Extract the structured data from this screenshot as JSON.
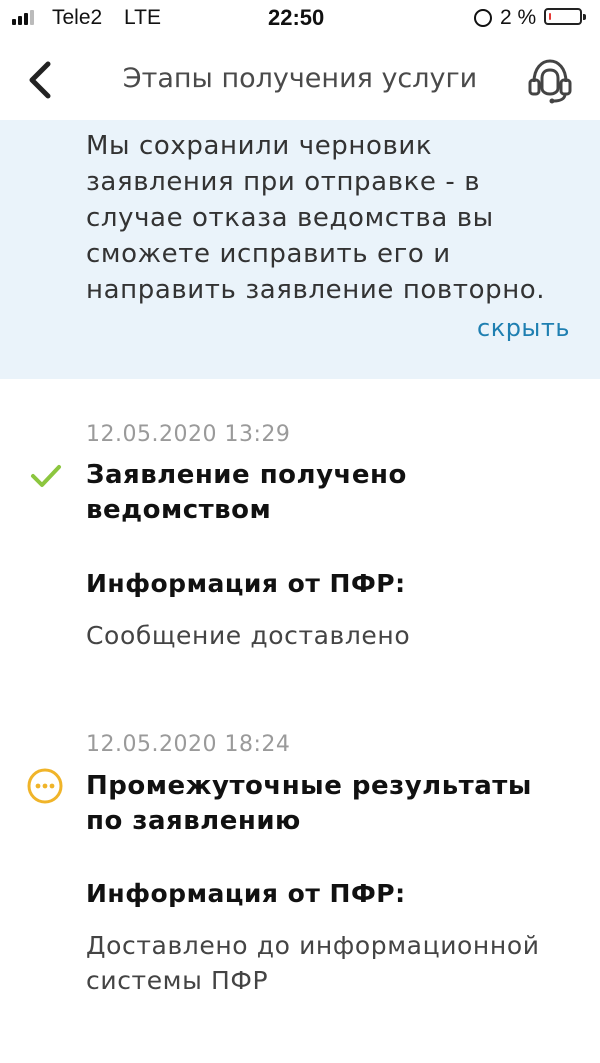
{
  "status_bar": {
    "carrier": "Tele2",
    "network": "LTE",
    "time": "22:50",
    "battery_percent": "2 %",
    "battery_level": 0.02
  },
  "header": {
    "title": "Этапы получения услуги",
    "back_icon": "chevron-left-icon",
    "support_icon": "headset-icon"
  },
  "banner": {
    "text": "Мы сохранили черновик заявления при отправке - в случае отказа ведомства вы сможете исправить его и направить заявление повторно.",
    "hide_label": "скрыть",
    "background": "#eaf3fa",
    "link_color": "#1f7fb1"
  },
  "events": [
    {
      "date": "12.05.2020 13:29",
      "title": "Заявление получено ведомством",
      "status_icon": "check-icon",
      "status_color": "#8cc63f",
      "org_label": "Информация от ПФР:",
      "message": "Сообщение доставлено"
    },
    {
      "date": "12.05.2020 18:24",
      "title": "Промежуточные результаты по заявлению",
      "status_icon": "pending-icon",
      "status_color": "#f0b429",
      "org_label": "Информация от ПФР:",
      "message": "Доставлено до информационной системы ПФР"
    }
  ]
}
